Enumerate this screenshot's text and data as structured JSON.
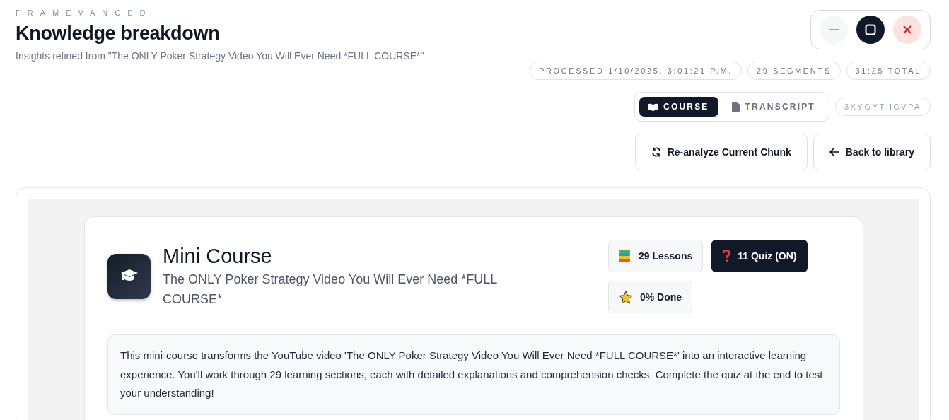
{
  "brand": "FRAMEVANCED",
  "title": "Knowledge breakdown",
  "subtitle": "Insights refined from \"The ONLY Poker Strategy Video You Will Ever Need *FULL COURSE*\"",
  "window_controls": [
    {
      "kind": "minimize"
    },
    {
      "kind": "maximize"
    },
    {
      "kind": "close"
    }
  ],
  "chips": [
    "PROCESSED 1/10/2025, 3:01:21 P.M.",
    "29 SEGMENTS",
    "31:25 TOTAL"
  ],
  "tabs": [
    {
      "label": "COURSE",
      "kind": "course",
      "selected": true
    },
    {
      "label": "TRANSCRIPT",
      "kind": "transcript",
      "selected": false
    }
  ],
  "video_id": "3KYGYTHCVPA",
  "actions": [
    {
      "label": "Re-analyze Current Chunk",
      "kind": "refresh"
    },
    {
      "label": "Back to library",
      "kind": "back"
    }
  ],
  "course": {
    "title": "Mini Course",
    "subtitle": "The ONLY Poker Strategy Video You Will Ever Need *FULL COURSE*",
    "badges": [
      {
        "label": "29 Lessons",
        "kind": "lessons",
        "highlighted": false
      },
      {
        "label": "11 Quiz (ON)",
        "kind": "quiz",
        "highlighted": true
      },
      {
        "label": "0% Done",
        "kind": "progress",
        "highlighted": false
      }
    ],
    "description": "This mini-course transforms the YouTube video 'The ONLY Poker Strategy Video You Will Ever Need *FULL COURSE*' into an interactive learning experience. You'll work through 29 learning sections, each with detailed explanations and comprehension checks. Complete the quiz at the end to test your understanding!"
  }
}
